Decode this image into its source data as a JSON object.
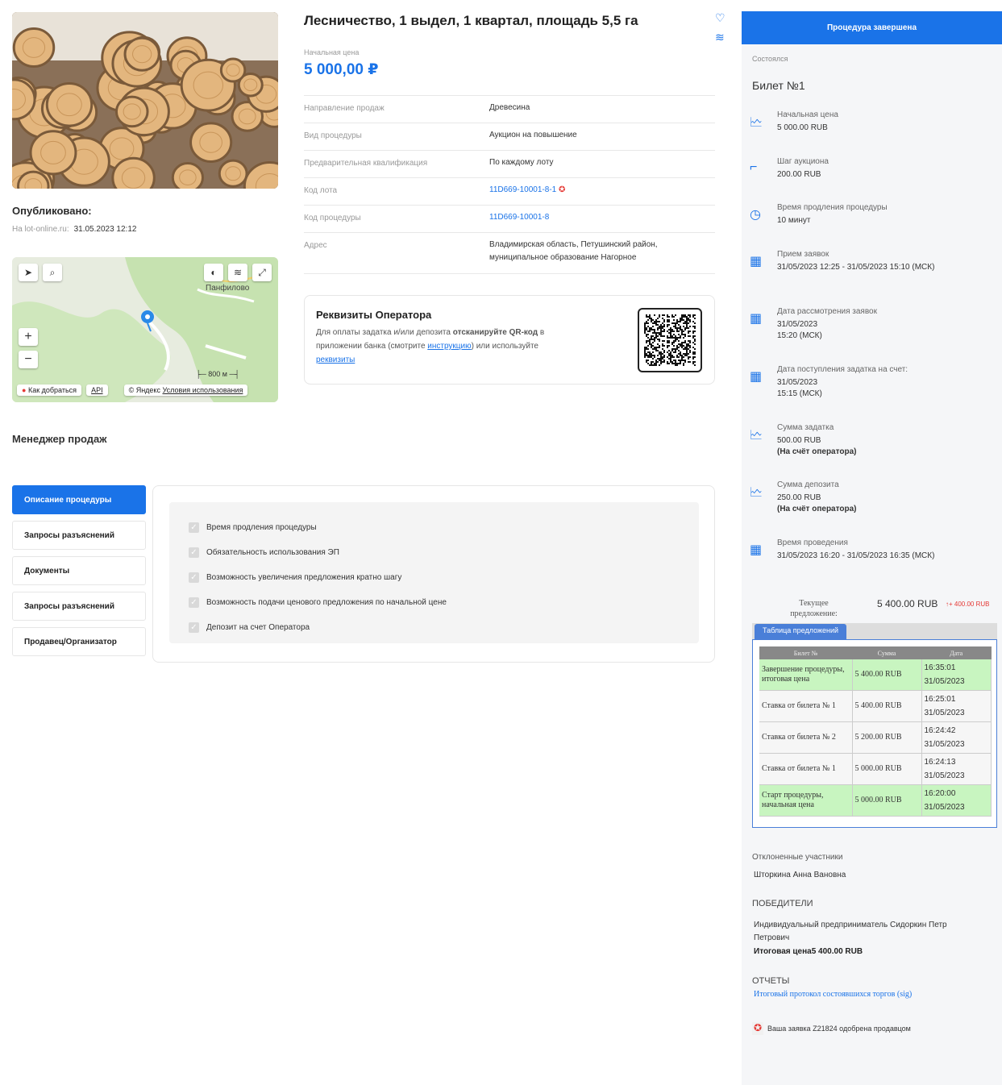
{
  "lot": {
    "title": "Лесничество, 1 выдел, 1 квартал, площадь 5,5 га",
    "start_price_label": "Начальная цена",
    "start_price": "5 000,00 ₽",
    "published_label": "Опубликовано:",
    "published_site": "На lot-online.ru:",
    "published_date": "31.05.2023 12:12",
    "properties": [
      {
        "key": "Направление продаж",
        "value": "Древесина"
      },
      {
        "key": "Вид процедуры",
        "value": "Аукцион на повышение"
      },
      {
        "key": "Предварительная квалификация",
        "value": "По каждому лоту"
      },
      {
        "key": "Код лота",
        "value": "11D669-10001-8-1"
      },
      {
        "key": "Код процедуры",
        "value": "11D669-10001-8"
      },
      {
        "key": "Адрес",
        "value": "Владимирская область, Петушинский район, муниципальное образование Нагорное"
      }
    ]
  },
  "map": {
    "place_label": "Панфилово",
    "scale": "800 м",
    "route_label": "Как добраться",
    "api_label": "API",
    "copyright": "© Яндекс",
    "terms_label": "Условия использования"
  },
  "operator": {
    "title": "Реквизиты Оператора",
    "text_1": "Для оплаты задатка и/или депозита ",
    "text_bold": "отсканируйте QR-код",
    "text_2": " в приложении банка (смотрите ",
    "link_instruction": "инструкцию",
    "text_3": ") или используйте ",
    "link_requisites": "реквизиты"
  },
  "manager_label": "Менеджер продаж",
  "tabs": [
    "Описание процедуры",
    "Запросы разъяснений",
    "Документы",
    "Запросы разъяснений",
    "Продавец/Организатор"
  ],
  "checks": [
    "Время продления процедуры",
    "Обязательность использования ЭП",
    "Возможность увеличения предложения кратно шагу",
    "Возможность подачи ценового предложения по начальной цене",
    "Депозит на счет Оператора"
  ],
  "side": {
    "status_button": "Процедура завершена",
    "state": "Состоялся",
    "ticket": "Билет №1",
    "items": [
      {
        "label": "Начальная цена",
        "value": "5 000.00 RUB",
        "icon": "money-icon"
      },
      {
        "label": "Шаг аукциона",
        "value": "200.00 RUB",
        "icon": "step-icon"
      },
      {
        "label": "Время продления процедуры",
        "value": "10 минут",
        "icon": "clock-icon"
      },
      {
        "label": "Прием заявок",
        "value": "31/05/2023 12:25  - 31/05/2023 15:10 (МСК)",
        "icon": "calendar-icon"
      },
      {
        "label": "Дата рассмотрения заявок",
        "value": "31/05/2023 15:20 (МСК)",
        "icon": "calendar-icon"
      },
      {
        "label": "Дата поступления задатка на счет:",
        "value": "31/05/2023 15:15 (МСК)",
        "icon": "calendar-icon"
      },
      {
        "label": "Сумма задатка",
        "value": "500.00 RUB",
        "value_bold": "(На счёт оператора)",
        "icon": "money-icon"
      },
      {
        "label": "Сумма депозита",
        "value": "250.00 RUB",
        "value_bold": "(На счёт оператора)",
        "icon": "money-icon"
      },
      {
        "label": "Время проведения",
        "value": "31/05/2023 16:20 - 31/05/2023 16:35 (МСК)",
        "icon": "calendar-icon"
      }
    ],
    "current_label": "Текущее предложение:",
    "current_value": "5 400.00 RUB",
    "current_increase": "+ 400.00 RUB",
    "table_tab": "Таблица предложений",
    "table_headers": [
      "Билет №",
      "Сумма",
      "Дата"
    ],
    "table_rows": [
      {
        "bid": "Завершение процедуры, итоговая цена",
        "sum": "5 400.00 RUB",
        "time": "16:35:01",
        "date": "31/05/2023",
        "highlight": true
      },
      {
        "bid": "Ставка от билета № 1",
        "sum": "5 400.00 RUB",
        "time": "16:25:01",
        "date": "31/05/2023",
        "highlight": false
      },
      {
        "bid": "Ставка от билета № 2",
        "sum": "5 200.00 RUB",
        "time": "16:24:42",
        "date": "31/05/2023",
        "highlight": false
      },
      {
        "bid": "Ставка от билета № 1",
        "sum": "5 000.00 RUB",
        "time": "16:24:13",
        "date": "31/05/2023",
        "highlight": false
      },
      {
        "bid": "Старт процедуры, начальная цена",
        "sum": "5 000.00 RUB",
        "time": "16:20:00",
        "date": "31/05/2023",
        "highlight": true
      }
    ],
    "rejected_label": "Отклоненные участники",
    "rejected_name": "Шторкина Анна Вановна",
    "winners_label": "ПОБЕДИТЕЛИ",
    "winner_name": "Индивидуальный предприниматель Сидоркин Петр Петрович",
    "winner_price": "Итоговая цена5 400.00 RUB",
    "reports_label": "ОТЧЕТЫ",
    "report_link": "Итоговый протокол состоявшихся торгов (sig)",
    "approval": "Ваша заявка Z21824 одобрена продавцом"
  }
}
